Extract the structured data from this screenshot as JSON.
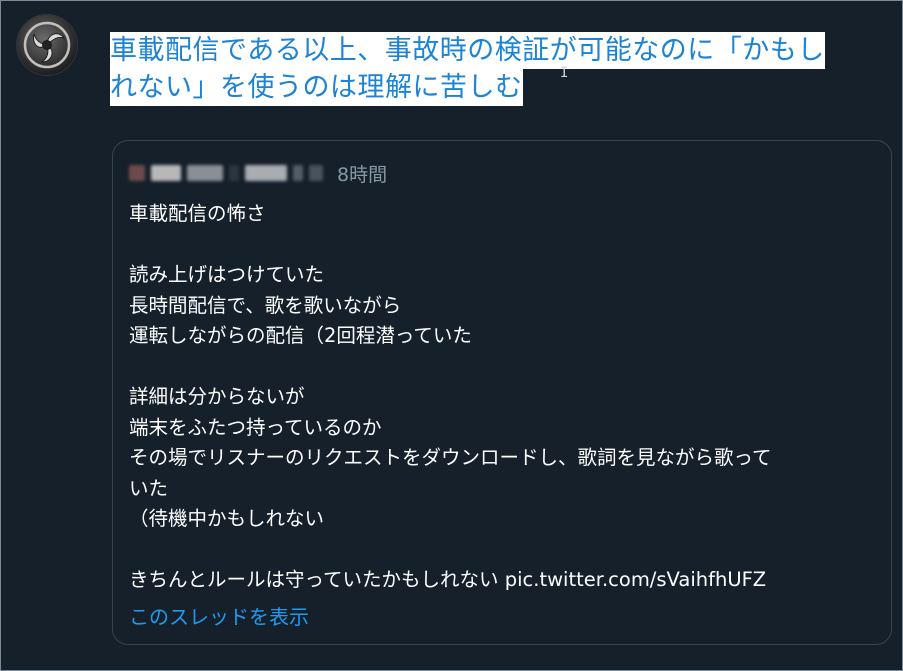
{
  "tweet": {
    "text_line1": "車載配信である以上、事故時の検証が可能なのに「かもし",
    "text_line2": "れない」を使うのは理解に苦しむ"
  },
  "quoted_tweet": {
    "timestamp": "8時間",
    "lines": [
      "車載配信の怖さ",
      "",
      "読み上げはつけていた",
      "長時間配信で、歌を歌いながら",
      "運転しながらの配信（2回程潜っていた",
      "",
      "詳細は分からないが",
      "端末をふたつ持っているのか",
      "その場でリスナーのリクエストをダウンロードし、歌詞を見ながら歌って",
      "いた",
      "（待機中かもしれない",
      "",
      "きちんとルールは守っていたかもしれない pic.twitter.com/sVaihfhUFZ"
    ],
    "show_thread_label": "このスレッドを表示"
  },
  "colors": {
    "background": "#15202b",
    "highlight_bg": "#ffffff",
    "highlight_text": "#1d83d4",
    "link": "#1d9bf0",
    "muted": "#8899a6",
    "border": "#38444d"
  },
  "icons": {
    "avatar": "tomoe-crest-avatar",
    "cursor": "text-cursor-icon"
  }
}
